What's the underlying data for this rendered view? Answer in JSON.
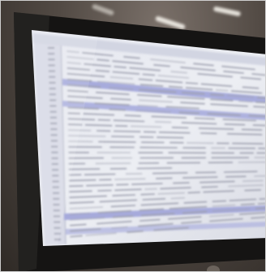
{
  "scene": {
    "colors": {
      "bezel": "#141414",
      "screen": "#e9eaf1",
      "highlight": "#a9aee0",
      "text": "#9a9caa"
    }
  }
}
